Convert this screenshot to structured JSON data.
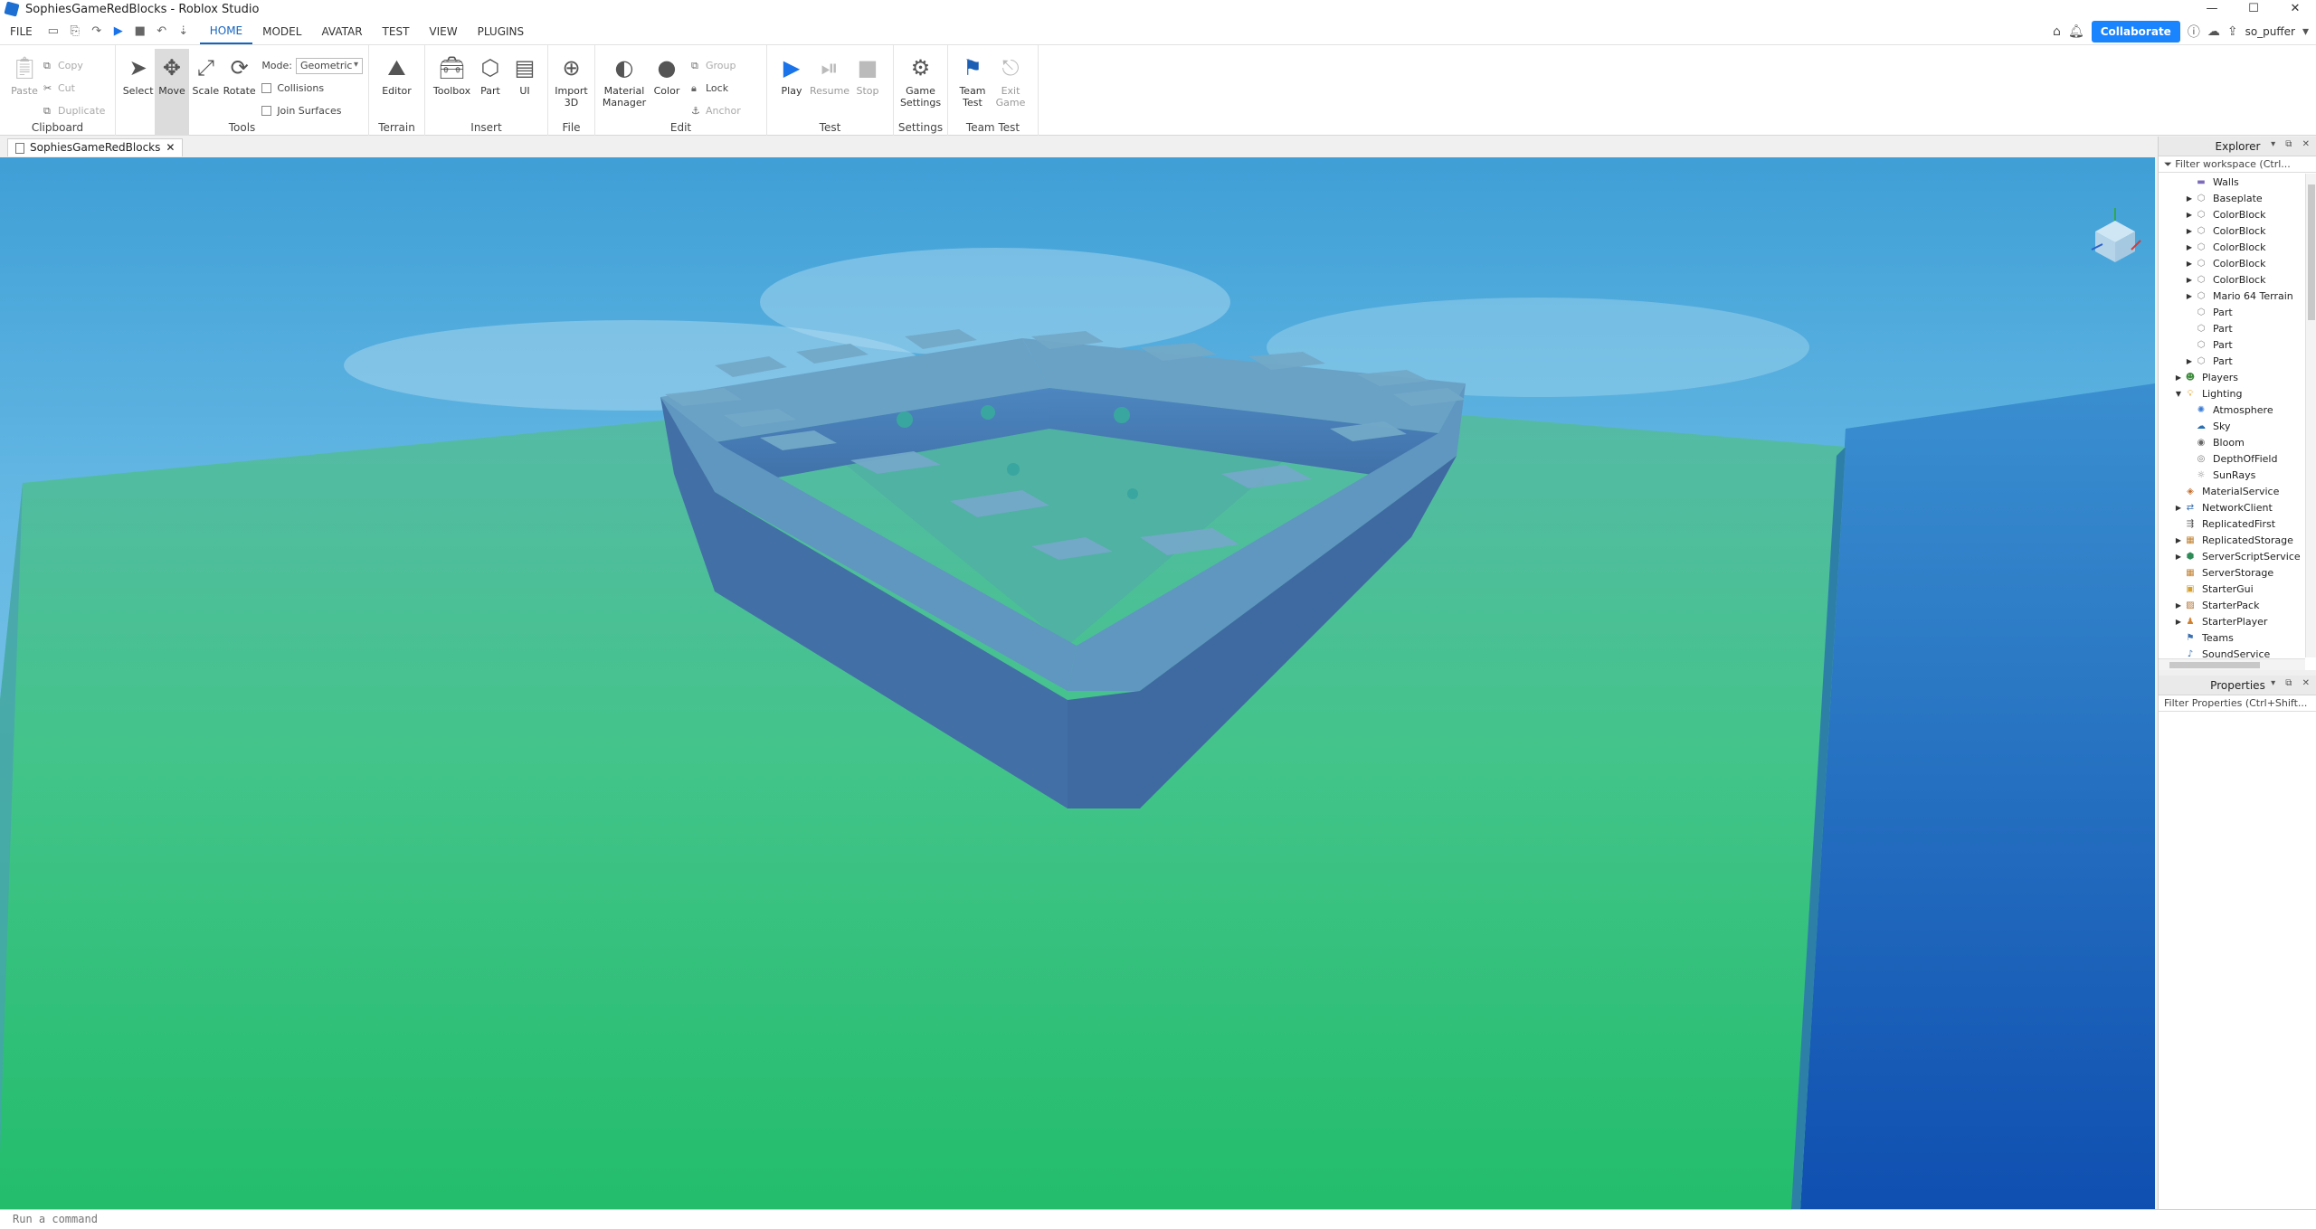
{
  "window": {
    "title": "SophiesGameRedBlocks - Roblox Studio",
    "controls": [
      "—",
      "☐",
      "✕"
    ]
  },
  "menu": {
    "file": "FILE",
    "tabs": [
      "HOME",
      "MODEL",
      "AVATAR",
      "TEST",
      "VIEW",
      "PLUGINS"
    ],
    "active_tab": "HOME",
    "collaborate": "Collaborate",
    "username": "so_puffer"
  },
  "ribbon": {
    "clipboard": {
      "label": "Clipboard",
      "paste": "Paste",
      "copy": "Copy",
      "cut": "Cut",
      "duplicate": "Duplicate"
    },
    "tools": {
      "label": "Tools",
      "select": "Select",
      "move": "Move",
      "scale": "Scale",
      "rotate": "Rotate",
      "mode_label": "Mode:",
      "mode_value": "Geometric",
      "collisions": "Collisions",
      "join_surfaces": "Join Surfaces"
    },
    "terrain": {
      "label": "Terrain",
      "editor": "Editor"
    },
    "insert": {
      "label": "Insert",
      "toolbox": "Toolbox",
      "part": "Part",
      "ui": "UI"
    },
    "file": {
      "label": "File",
      "import3d_line1": "Import",
      "import3d_line2": "3D"
    },
    "edit": {
      "label": "Edit",
      "material_line1": "Material",
      "material_line2": "Manager",
      "color": "Color",
      "group": "Group",
      "lock": "Lock",
      "anchor": "Anchor"
    },
    "test": {
      "label": "Test",
      "play": "Play",
      "resume": "Resume",
      "stop": "Stop"
    },
    "settings": {
      "label": "Settings",
      "game_line1": "Game",
      "game_line2": "Settings"
    },
    "teamtest": {
      "label": "Team Test",
      "team_line1": "Team",
      "team_line2": "Test",
      "exit_line1": "Exit",
      "exit_line2": "Game"
    }
  },
  "doc_tab": {
    "name": "SophiesGameRedBlocks",
    "close": "✕"
  },
  "explorer": {
    "title": "Explorer",
    "filter": "Filter workspace (Ctrl...",
    "items": [
      {
        "label": "Walls",
        "indent": 2,
        "arrow": "",
        "icon": "folder",
        "color": "#7b6bb8"
      },
      {
        "label": "Baseplate",
        "indent": 2,
        "arrow": "▶",
        "icon": "part",
        "color": "#888888"
      },
      {
        "label": "ColorBlock",
        "indent": 2,
        "arrow": "▶",
        "icon": "part",
        "color": "#888888"
      },
      {
        "label": "ColorBlock",
        "indent": 2,
        "arrow": "▶",
        "icon": "part",
        "color": "#888888"
      },
      {
        "label": "ColorBlock",
        "indent": 2,
        "arrow": "▶",
        "icon": "part",
        "color": "#888888"
      },
      {
        "label": "ColorBlock",
        "indent": 2,
        "arrow": "▶",
        "icon": "part",
        "color": "#888888"
      },
      {
        "label": "ColorBlock",
        "indent": 2,
        "arrow": "▶",
        "icon": "part",
        "color": "#888888"
      },
      {
        "label": "Mario 64 Terrain",
        "indent": 2,
        "arrow": "▶",
        "icon": "part",
        "color": "#888888"
      },
      {
        "label": "Part",
        "indent": 2,
        "arrow": "",
        "icon": "part",
        "color": "#888888"
      },
      {
        "label": "Part",
        "indent": 2,
        "arrow": "",
        "icon": "part",
        "color": "#888888"
      },
      {
        "label": "Part",
        "indent": 2,
        "arrow": "",
        "icon": "part",
        "color": "#888888"
      },
      {
        "label": "Part",
        "indent": 2,
        "arrow": "▶",
        "icon": "part",
        "color": "#888888"
      },
      {
        "label": "Players",
        "indent": 1,
        "arrow": "▶",
        "icon": "players",
        "color": "#3c8b3c"
      },
      {
        "label": "Lighting",
        "indent": 1,
        "arrow": "▼",
        "icon": "lighting",
        "color": "#e0a020"
      },
      {
        "label": "Atmosphere",
        "indent": 2,
        "arrow": "",
        "icon": "atmosphere",
        "color": "#3a7bd5"
      },
      {
        "label": "Sky",
        "indent": 2,
        "arrow": "",
        "icon": "sky",
        "color": "#2a6fb0"
      },
      {
        "label": "Bloom",
        "indent": 2,
        "arrow": "",
        "icon": "bloom",
        "color": "#666666"
      },
      {
        "label": "DepthOfField",
        "indent": 2,
        "arrow": "",
        "icon": "dof",
        "color": "#777777"
      },
      {
        "label": "SunRays",
        "indent": 2,
        "arrow": "",
        "icon": "sunrays",
        "color": "#888888"
      },
      {
        "label": "MaterialService",
        "indent": 1,
        "arrow": "",
        "icon": "material",
        "color": "#c07030"
      },
      {
        "label": "NetworkClient",
        "indent": 1,
        "arrow": "▶",
        "icon": "network",
        "color": "#3a6fb0"
      },
      {
        "label": "ReplicatedFirst",
        "indent": 1,
        "arrow": "",
        "icon": "replicated",
        "color": "#555555"
      },
      {
        "label": "ReplicatedStorage",
        "indent": 1,
        "arrow": "▶",
        "icon": "storage",
        "color": "#c08030"
      },
      {
        "label": "ServerScriptService",
        "indent": 1,
        "arrow": "▶",
        "icon": "script",
        "color": "#2e8b57"
      },
      {
        "label": "ServerStorage",
        "indent": 1,
        "arrow": "",
        "icon": "storage",
        "color": "#c08030"
      },
      {
        "label": "StarterGui",
        "indent": 1,
        "arrow": "",
        "icon": "gui",
        "color": "#d4a030"
      },
      {
        "label": "StarterPack",
        "indent": 1,
        "arrow": "▶",
        "icon": "pack",
        "color": "#b07030"
      },
      {
        "label": "StarterPlayer",
        "indent": 1,
        "arrow": "▶",
        "icon": "player",
        "color": "#d08030"
      },
      {
        "label": "Teams",
        "indent": 1,
        "arrow": "",
        "icon": "teams",
        "color": "#3a6fb0"
      },
      {
        "label": "SoundService",
        "indent": 1,
        "arrow": "",
        "icon": "sound",
        "color": "#3a6fb0"
      }
    ]
  },
  "properties": {
    "title": "Properties",
    "filter": "Filter Properties (Ctrl+Shift..."
  },
  "command_bar": {
    "placeholder": "Run a command"
  },
  "colors": {
    "accent": "#1565c0",
    "collaborate": "#1a84ff",
    "sky_top": "#3f9fd6",
    "ground": "#2ec27a"
  }
}
